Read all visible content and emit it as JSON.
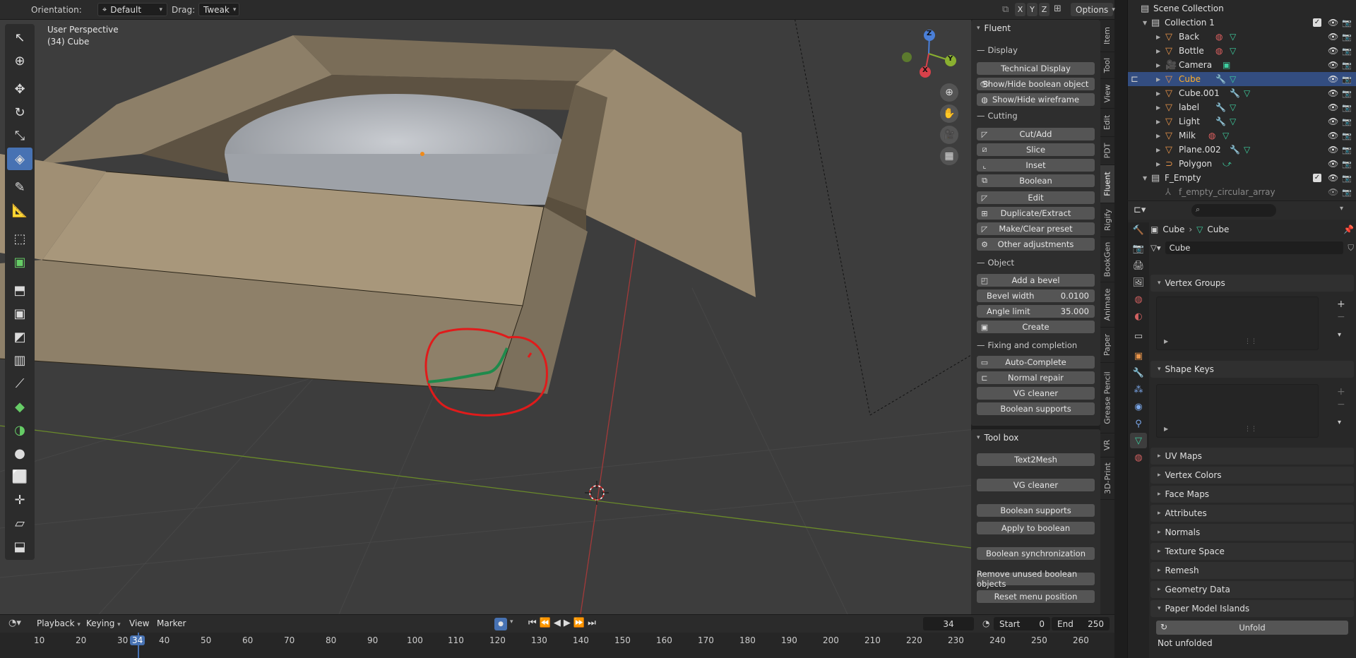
{
  "header": {
    "orientation_label": "Orientation:",
    "orientation_value": "Default",
    "drag_label": "Drag:",
    "drag_value": "Tweak",
    "axis_x": "X",
    "axis_y": "Y",
    "axis_z": "Z",
    "options_label": "Options"
  },
  "viewport": {
    "perspective": "User Perspective",
    "object_info": "(34) Cube",
    "gizmo_z": "Z",
    "gizmo_y": "Y",
    "gizmo_x": "X"
  },
  "sidebar_tabs": [
    "Item",
    "Tool",
    "View",
    "Edit",
    "PDT",
    "Fluent",
    "Rigify",
    "BookGen",
    "Animate",
    "Paper",
    "Grease Pencil",
    "VR",
    "3D-Print"
  ],
  "fluent": {
    "title": "Fluent",
    "display_header": "Display",
    "technical_display": "Technical Display",
    "show_hide_boolean": "Show/Hide boolean object",
    "show_hide_wireframe": "Show/Hide wireframe",
    "cutting_header": "Cutting",
    "cut_add": "Cut/Add",
    "slice": "Slice",
    "inset": "Inset",
    "boolean": "Boolean",
    "edit": "Edit",
    "duplicate_extract": "Duplicate/Extract",
    "make_clear_preset": "Make/Clear preset",
    "other_adjustments": "Other adjustments",
    "object_header": "Object",
    "add_bevel": "Add a bevel",
    "bevel_width_label": "Bevel width",
    "bevel_width_value": "0.0100",
    "angle_limit_label": "Angle limit",
    "angle_limit_value": "35.000",
    "create": "Create",
    "fixing_header": "Fixing and completion",
    "auto_complete": "Auto-Complete",
    "normal_repair": "Normal repair",
    "vg_cleaner": "VG cleaner",
    "boolean_supports": "Boolean supports"
  },
  "toolbox": {
    "title": "Tool box",
    "text2mesh": "Text2Mesh",
    "vg_cleaner": "VG cleaner",
    "boolean_supports": "Boolean supports",
    "apply_to_boolean": "Apply to boolean",
    "boolean_sync": "Boolean synchronization",
    "remove_unused": "Remove unused boolean objects",
    "reset_menu": "Reset menu position"
  },
  "outliner": {
    "scene_collection": "Scene Collection",
    "collection1": "Collection 1",
    "items": [
      {
        "name": "Back"
      },
      {
        "name": "Bottle"
      },
      {
        "name": "Camera"
      },
      {
        "name": "Cube"
      },
      {
        "name": "Cube.001"
      },
      {
        "name": "label"
      },
      {
        "name": "Light"
      },
      {
        "name": "Milk"
      },
      {
        "name": "Plane.002"
      },
      {
        "name": "Polygon"
      }
    ],
    "f_empty": "F_Empty",
    "f_empty_child": "f_empty_circular_array"
  },
  "properties": {
    "breadcrumb_object": "Cube",
    "breadcrumb_data": "Cube",
    "mesh_name": "Cube",
    "sections": {
      "vertex_groups": "Vertex Groups",
      "shape_keys": "Shape Keys",
      "uv_maps": "UV Maps",
      "vertex_colors": "Vertex Colors",
      "face_maps": "Face Maps",
      "attributes": "Attributes",
      "normals": "Normals",
      "texture_space": "Texture Space",
      "remesh": "Remesh",
      "geometry_data": "Geometry Data",
      "paper_model": "Paper Model Islands"
    },
    "unfold": "Unfold",
    "not_unfolded": "Not unfolded"
  },
  "timeline": {
    "playback": "Playback",
    "keying": "Keying",
    "view": "View",
    "marker": "Marker",
    "current_frame": "34",
    "start_label": "Start",
    "start_value": "0",
    "end_label": "End",
    "end_value": "250",
    "ticks": [
      "10",
      "20",
      "30",
      "34",
      "40",
      "50",
      "60",
      "70",
      "80",
      "90",
      "100",
      "110",
      "120",
      "130",
      "140",
      "150",
      "160",
      "170",
      "180",
      "190",
      "200",
      "210",
      "220",
      "230",
      "240",
      "250",
      "260"
    ]
  },
  "colors": {
    "accent": "#4772b3",
    "selection": "#334d80",
    "annotation_red": "#e01b1b",
    "annotation_green": "#1f8a4c",
    "cardboard": "#a8977b"
  }
}
